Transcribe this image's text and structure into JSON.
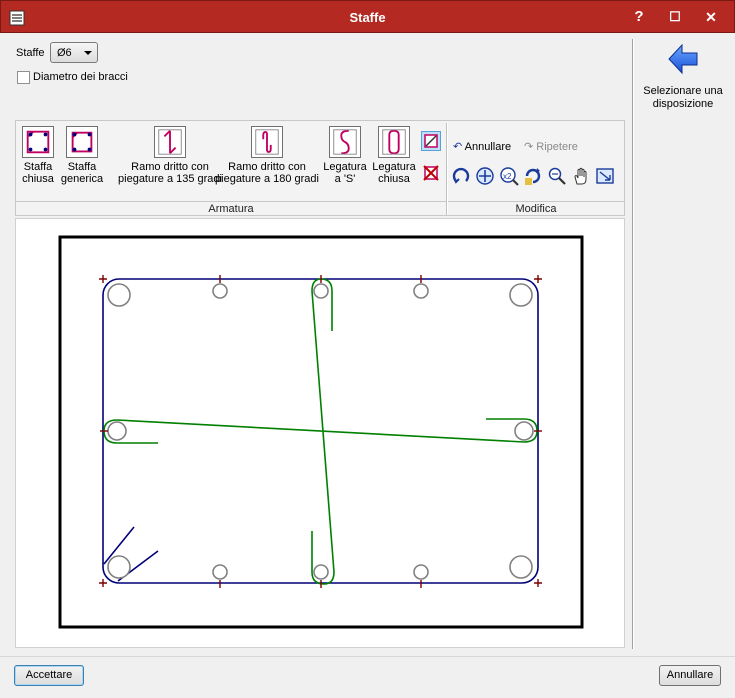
{
  "window": {
    "title": "Staffe"
  },
  "titlebar": {
    "help": "?",
    "maximize": "☐",
    "close": "✕"
  },
  "staffe": {
    "label": "Staffe",
    "selected": "Ø6"
  },
  "diametro": {
    "label": "Diametro dei bracci",
    "checked": false
  },
  "right_panel": {
    "back_label": "Selezionare una disposizione"
  },
  "toolbar": {
    "armatura_caption": "Armatura",
    "modifica_caption": "Modifica",
    "buttons": [
      {
        "label1": "Staffa",
        "label2": "chiusa"
      },
      {
        "label1": "Staffa",
        "label2": "generica"
      },
      {
        "label1": "Ramo dritto con",
        "label2": "piegature a 135 gradi"
      },
      {
        "label1": "Ramo dritto con",
        "label2": "piegature a 180 gradi"
      },
      {
        "label1": "Legatura",
        "label2": "a 'S'"
      },
      {
        "label1": "Legatura",
        "label2": "chiusa"
      }
    ],
    "undo": "Annullare",
    "redo": "Ripetere"
  },
  "footer": {
    "accept": "Accettare",
    "cancel": "Annullare"
  },
  "colors": {
    "titlebar": "#b42a22",
    "stirrup": "#00007a",
    "tie": "#008000",
    "bar": "#808080",
    "marker": "#7a0000"
  },
  "icons": [
    "app-icon",
    "help-icon",
    "maximize-icon",
    "close-icon",
    "back-arrow-icon",
    "edit-selected-icon",
    "delete-icon",
    "undo-icon",
    "redo-icon",
    "rotate-icon",
    "move-icon",
    "scale-icon",
    "rotate-arrow-icon",
    "zoom-icon",
    "pan-hand-icon",
    "zoom-extents-icon"
  ]
}
